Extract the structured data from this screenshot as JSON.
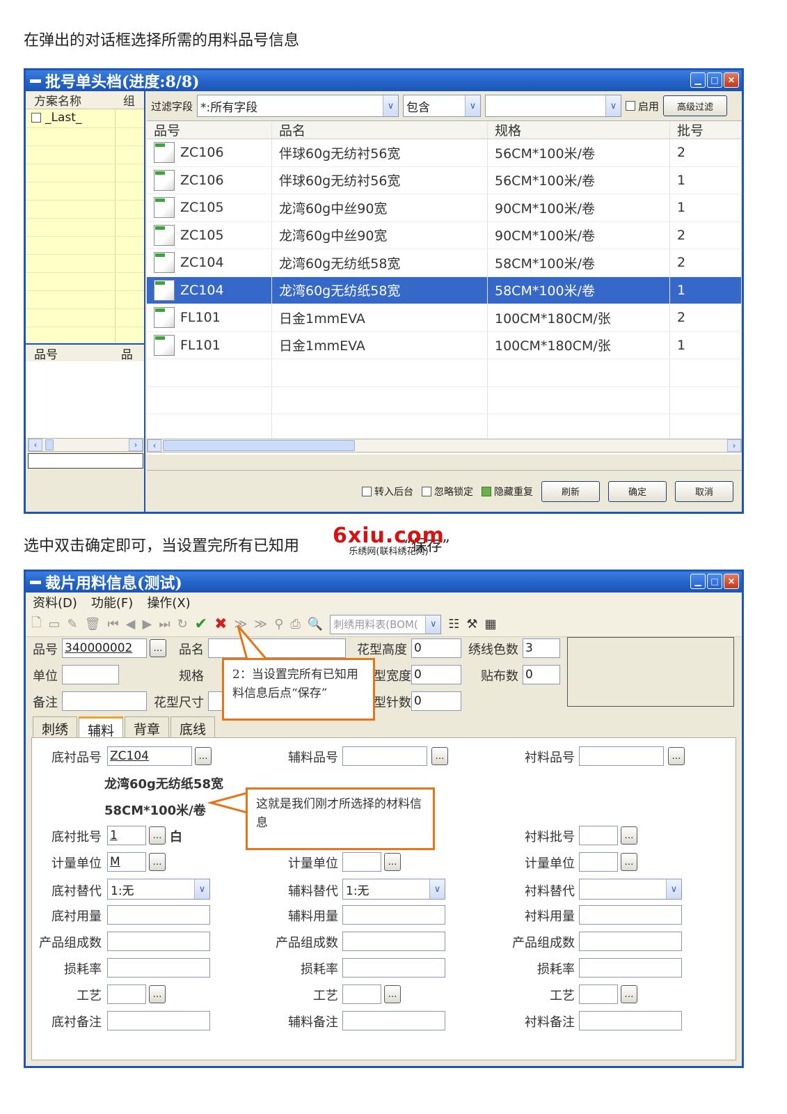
{
  "doc": {
    "line1": "在弹出的对话框选择所需的用料品号信息",
    "line2_a": "选中双击确定即可，当设置完所有已知用",
    "line2_b": "“保存”"
  },
  "watermark": {
    "logo": "6xiu.com",
    "sub": "乐绣网(联科绣花网)"
  },
  "dialog1": {
    "title": "批号单头档(进度:8/8)",
    "scheme": {
      "col1": "方案名称",
      "col2": "组",
      "item": "_Last_"
    },
    "sub": {
      "col1": "品号",
      "col2": "品名"
    },
    "filter": {
      "field_label": "过滤字段",
      "field_value": "*:所有字段",
      "op_value": "包含",
      "enable_label": "启用",
      "adv_button": "高级过滤"
    },
    "grid": {
      "headers": [
        "品号",
        "品名",
        "规格",
        "批号"
      ],
      "rows": [
        [
          "ZC106",
          "伴球60g无纺衬56宽",
          "56CM*100米/卷",
          "2"
        ],
        [
          "ZC106",
          "伴球60g无纺衬56宽",
          "56CM*100米/卷",
          "1"
        ],
        [
          "ZC105",
          "龙湾60g中丝90宽",
          "90CM*100米/卷",
          "1"
        ],
        [
          "ZC105",
          "龙湾60g中丝90宽",
          "90CM*100米/卷",
          "2"
        ],
        [
          "ZC104",
          "龙湾60g无纺纸58宽",
          "58CM*100米/卷",
          "2"
        ],
        [
          "ZC104",
          "龙湾60g无纺纸58宽",
          "58CM*100米/卷",
          "1"
        ],
        [
          "FL101",
          "日金1mmEVA",
          "100CM*180CM/张",
          "2"
        ],
        [
          "FL101",
          "日金1mmEVA",
          "100CM*180CM/张",
          "1"
        ]
      ],
      "selected_index": 5
    },
    "bottom": {
      "cb1": "转入后台",
      "cb2": "忽略锁定",
      "cb3": "隐藏重复",
      "refresh": "刷新",
      "ok": "确定",
      "cancel": "取消"
    }
  },
  "dialog2": {
    "title": "裁片用料信息(测试)",
    "menu": [
      "资料(D)",
      "功能(F)",
      "操作(X)"
    ],
    "toolbar_combo": "刺绣用料表(BOM(",
    "header": {
      "pinhao_label": "品号",
      "pinhao_value": "340000002",
      "pinming_label": "品名",
      "danwei_label": "单位",
      "guige_label": "规格",
      "beizhu_label": "备注",
      "chicun_label": "花型尺寸",
      "gaodu_label": "花型高度",
      "gaodu_value": "0",
      "kuandu_label": "型宽度",
      "kuandu_value": "0",
      "zhenshu_label": "型针数",
      "zhenshu_value": "0",
      "sese_label": "绣线色数",
      "sese_value": "3",
      "tiebu_label": "贴布数",
      "tiebu_value": "0"
    },
    "tabs": [
      "刺绣",
      "辅料",
      "背章",
      "底线"
    ],
    "active_tab": 1,
    "col1": {
      "pinhao_label": "底衬品号",
      "pinhao_value": "ZC104",
      "name_text": "龙湾60g无纺纸58宽",
      "spec_text": "58CM*100米/卷",
      "pihao_label": "底衬批号",
      "pihao_value": "1",
      "pihao_suffix": "白",
      "unit_label": "计量单位",
      "unit_value": "M",
      "sub_label": "底衬替代",
      "sub_value": "1:无",
      "yongliang_label": "底衬用量",
      "zucheng_label": "产品组成数",
      "sunhao_label": "损耗率",
      "gongyi_label": "工艺",
      "note_label": "底衬备注"
    },
    "col2": {
      "pinhao_label": "辅料品号",
      "unit_label": "计量单位",
      "sub_label": "辅料替代",
      "sub_value": "1:无",
      "yongliang_label": "辅料用量",
      "zucheng_label": "产品组成数",
      "sunhao_label": "损耗率",
      "gongyi_label": "工艺",
      "note_label": "辅料备注"
    },
    "col3": {
      "pinhao_label": "衬料品号",
      "pihao_label": "衬料批号",
      "unit_label": "计量单位",
      "sub_label": "衬料替代",
      "yongliang_label": "衬料用量",
      "zucheng_label": "产品组成数",
      "sunhao_label": "损耗率",
      "gongyi_label": "工艺",
      "note_label": "衬料备注"
    },
    "callout_save": "2：当设置完所有已知用料信息后点“保存”",
    "callout_info": "这就是我们刚才所选择的材料信息"
  }
}
